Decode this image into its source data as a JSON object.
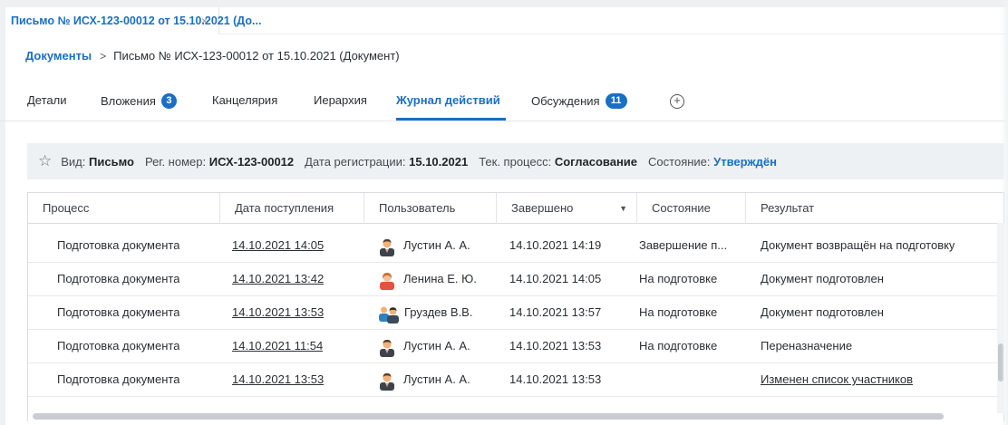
{
  "document_tab": {
    "title": "Письмо № ИСХ-123-00012 от 15.10.2021 (До...",
    "close": "×"
  },
  "breadcrumb": {
    "root": "Документы",
    "separator": ">",
    "current": "Письмо № ИСХ-123-00012 от 15.10.2021 (Документ)"
  },
  "tabs": [
    {
      "label": "Детали"
    },
    {
      "label": "Вложения",
      "badge": "3"
    },
    {
      "label": "Канцелярия"
    },
    {
      "label": "Иерархия"
    },
    {
      "label": "Журнал действий",
      "active": true
    },
    {
      "label": "Обсуждения",
      "badge": "11"
    }
  ],
  "add_tab_icon": "plus-circle-icon",
  "info": {
    "kind_label": "Вид:",
    "kind_value": "Письмо",
    "reg_label": "Рег. номер:",
    "reg_value": "ИСХ-123-00012",
    "date_label": "Дата регистрации:",
    "date_value": "15.10.2021",
    "process_label": "Тек. процесс:",
    "process_value": "Согласование",
    "state_label": "Состояние:",
    "state_value": "Утверждён"
  },
  "table": {
    "columns": [
      "Процесс",
      "Дата поступления",
      "Пользователь",
      "Завершено",
      "Состояние",
      "Результат"
    ],
    "rows": [
      {
        "process": "Подготовка документа",
        "date_in": "14.10.2021 14:05",
        "user": "Лустин А. А.",
        "avatar": "male-dark",
        "completed": "14.10.2021 14:19",
        "state": "Завершение п...",
        "result": "Документ возвращён на подготовку"
      },
      {
        "process": "Подготовка документа",
        "date_in": "14.10.2021 13:42",
        "user": "Ленина Е. Ю.",
        "avatar": "female",
        "completed": "14.10.2021 14:05",
        "state": "На подготовке",
        "result": "Документ подготовлен"
      },
      {
        "process": "Подготовка документа",
        "date_in": "14.10.2021 13:53",
        "user": "Груздев В.В.",
        "avatar": "group",
        "completed": "14.10.2021 13:57",
        "state": "На подготовке",
        "result": "Документ подготовлен"
      },
      {
        "process": "Подготовка документа",
        "date_in": "14.10.2021 11:54",
        "user": "Лустин А. А.",
        "avatar": "male-dark",
        "completed": "14.10.2021 13:53",
        "state": "На подготовке",
        "result": "Переназначение"
      },
      {
        "process": "Подготовка документа",
        "date_in": "14.10.2021 13:53",
        "user": "Лустин А. А.",
        "avatar": "male-dark",
        "completed": "14.10.2021 13:53",
        "state": "",
        "result": "Изменен список участников",
        "result_link": true
      }
    ]
  },
  "colors": {
    "accent": "#1a6fc4",
    "info_bar_bg": "#eef1f4"
  }
}
